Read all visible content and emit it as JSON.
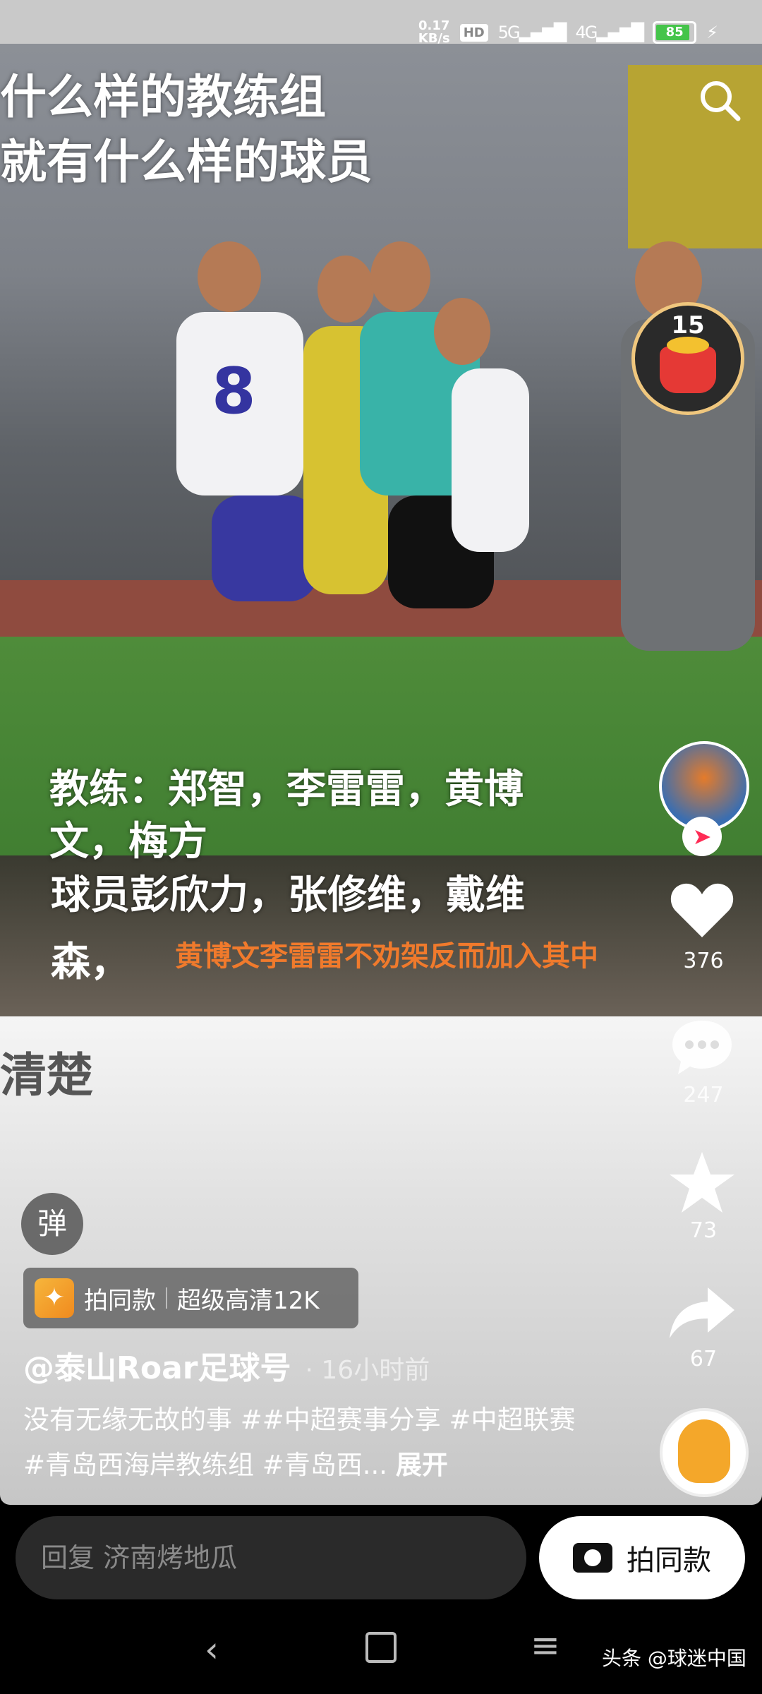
{
  "status_bar": {
    "net_speed": "0.17",
    "net_unit": "KB/s",
    "hd_badge": "HD",
    "signal1": "5G",
    "signal2": "4G",
    "battery": "85"
  },
  "video": {
    "caption_top_line1": "什么样的教练组",
    "caption_top_line2": "就有什么样的球员",
    "subtitle_line1": "教练：郑智，李雷雷，黄博",
    "subtitle_line2": "文，梅方",
    "subtitle_line3": "球员彭欣力，张修维，戴维",
    "subtitle_line4": "森，",
    "subtitle_orange": "黄博文李雷雷不劝架反而加入其中",
    "lower_faded": "清楚",
    "player_number": "8"
  },
  "reward": {
    "count": "15"
  },
  "actions": {
    "like_count": "376",
    "comment_count": "247",
    "favorite_count": "73",
    "share_count": "67"
  },
  "danmu_label": "弹",
  "same_style": {
    "label1": "拍同款",
    "label2": "超级高清12K"
  },
  "author": {
    "name": "@泰山Roar足球号",
    "time": "· 16小时前"
  },
  "description": {
    "text": "没有无缘无故的事 ##中超赛事分享 #中超联赛 #青岛西海岸教练组 #青岛西...",
    "more": "展开"
  },
  "comment_bar": {
    "reply_placeholder": "回复 济南烤地瓜",
    "shoot_label": "拍同款"
  },
  "watermark": "头条 @球迷中国",
  "colors": {
    "accent_orange": "#f07a2c",
    "follow_red": "#fe2c55",
    "battery_green": "#45c44a"
  }
}
